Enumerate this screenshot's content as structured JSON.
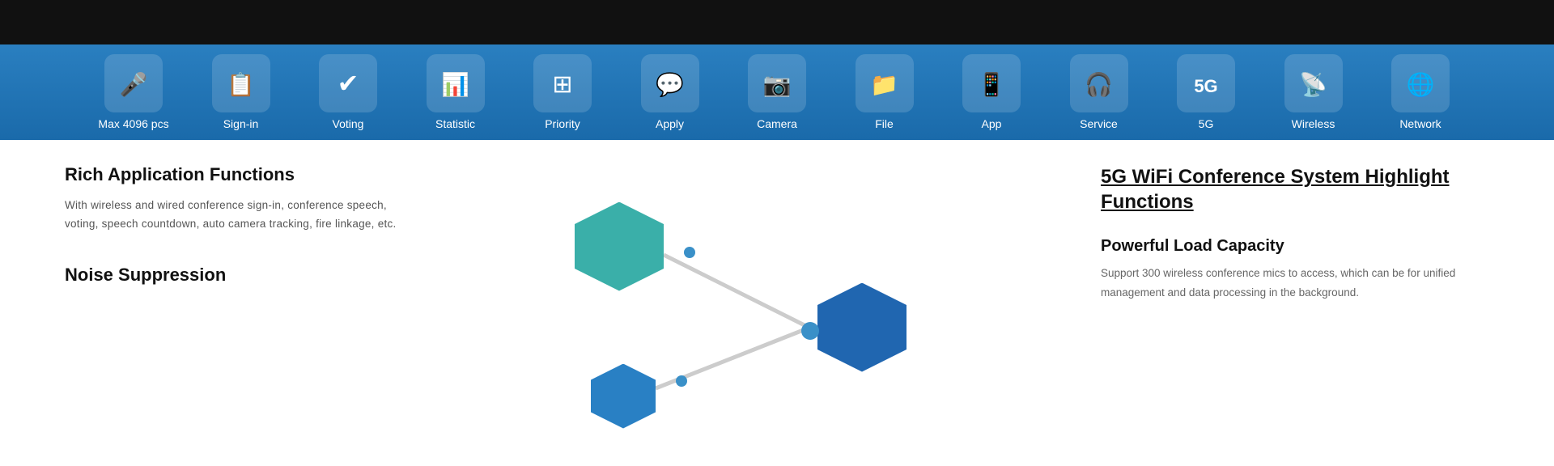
{
  "topBar": {
    "bg": "#111"
  },
  "iconBar": {
    "items": [
      {
        "id": "max4096",
        "label": "Max 4096 pcs",
        "iconClass": "icon-mic"
      },
      {
        "id": "signin",
        "label": "Sign-in",
        "iconClass": "icon-signin"
      },
      {
        "id": "voting",
        "label": "Voting",
        "iconClass": "icon-voting"
      },
      {
        "id": "statistic",
        "label": "Statistic",
        "iconClass": "icon-stat"
      },
      {
        "id": "priority",
        "label": "Priority",
        "iconClass": "icon-priority"
      },
      {
        "id": "apply",
        "label": "Apply",
        "iconClass": "icon-apply"
      },
      {
        "id": "camera",
        "label": "Camera",
        "iconClass": "icon-camera"
      },
      {
        "id": "file",
        "label": "File",
        "iconClass": "icon-file"
      },
      {
        "id": "app",
        "label": "App",
        "iconClass": "icon-app"
      },
      {
        "id": "service",
        "label": "Service",
        "iconClass": "icon-service"
      },
      {
        "id": "5g",
        "label": "5G",
        "iconClass": "icon-5g"
      },
      {
        "id": "wireless",
        "label": "Wireless",
        "iconClass": "icon-wireless"
      },
      {
        "id": "network",
        "label": "Network",
        "iconClass": "icon-network"
      }
    ]
  },
  "leftSection": {
    "title1": "Rich Application Functions",
    "desc1": "With wireless and wired conference sign-in, conference speech, voting, speech countdown, auto camera tracking, fire linkage, etc.",
    "title2": "Noise Suppression"
  },
  "rightSection": {
    "mainTitle": "5G WiFi Conference System  Highlight Functions",
    "subTitle": "Powerful Load Capacity",
    "desc": "Support 300 wireless conference mics to access, which can be  for unified management and data processing in the background."
  }
}
